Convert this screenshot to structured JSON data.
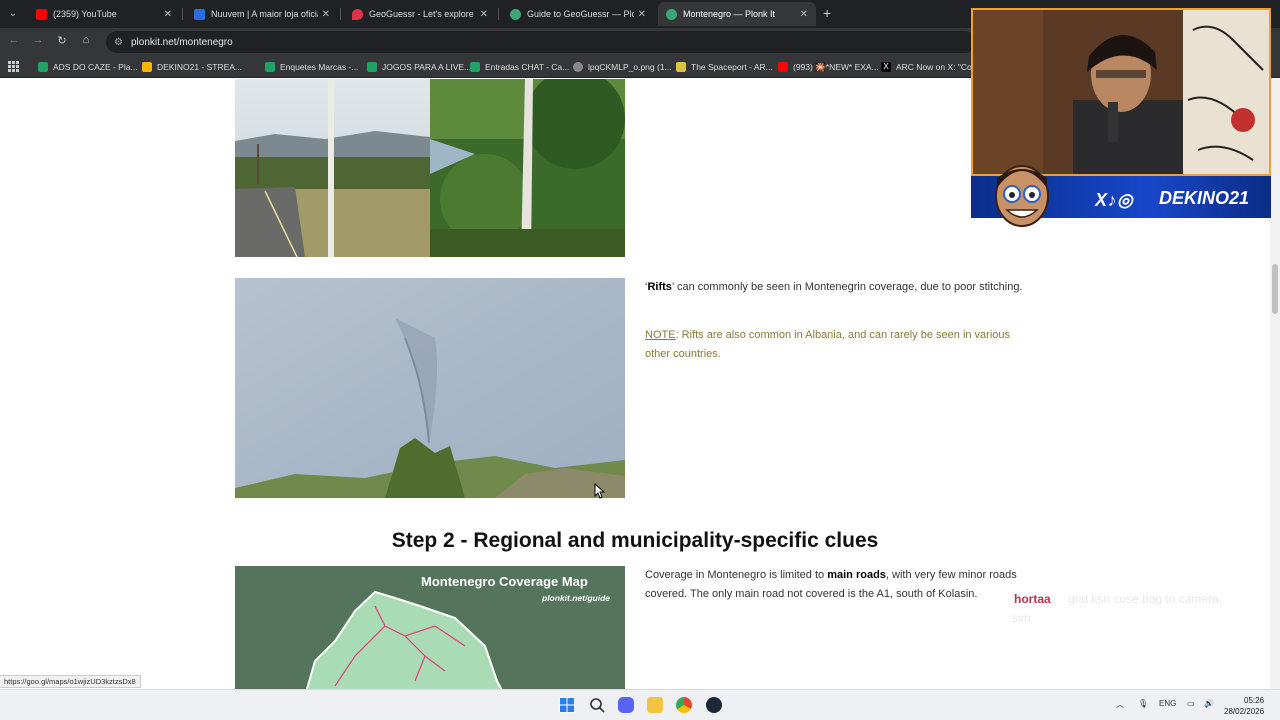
{
  "browser": {
    "tabs": [
      {
        "label": "(2359) YouTube",
        "color": "#ff0000",
        "icon": "youtube-icon"
      },
      {
        "label": "Nuuvem | A maior loja oficial de",
        "color": "#2b6de0",
        "icon": "nuuvem-icon"
      },
      {
        "label": "GeoGuessr - Let's explore the w",
        "color": "#e0334a",
        "icon": "map-pin-icon"
      },
      {
        "label": "Guide to GeoGuessr — Plonk It",
        "color": "#3aa876",
        "icon": "plonkit-icon"
      },
      {
        "label": "Montenegro — Plonk It",
        "color": "#3aa876",
        "icon": "plonkit-icon"
      }
    ],
    "url": "plonkit.net/montenegro",
    "bookmarks": [
      {
        "label": "ADS DO CAZE - Pla...",
        "color": "#1ea362",
        "icon": "sheets-icon"
      },
      {
        "label": "DEKINO21 - STREA...",
        "color": "#f4b400",
        "icon": "drive-icon"
      },
      {
        "label": "Enquetes Marcas -...",
        "color": "#1ea362",
        "icon": "sheets-icon"
      },
      {
        "label": "JOGOS PARA A LIVE...",
        "color": "#1ea362",
        "icon": "sheets-icon"
      },
      {
        "label": "Entradas CHAT - Ca...",
        "color": "#1ea362",
        "icon": "sheets-icon"
      },
      {
        "label": "lpqCKMLP_o.png (1...",
        "color": "#888888",
        "icon": "globe-icon"
      },
      {
        "label": "The Spaceport - AR...",
        "color": "#d9c341",
        "icon": "spaceport-icon"
      },
      {
        "label": "(993) 🎇*NEW* EXA...",
        "color": "#ff0000",
        "icon": "youtube-icon"
      },
      {
        "label": "ARC Now on X: \"Co...",
        "color": "#000000",
        "icon": "x-icon"
      }
    ]
  },
  "content": {
    "rifts_bold": "Rifts",
    "rifts_text": " can commonly be seen in Montenegrin coverage, due to poor stitching.",
    "note_label": "NOTE",
    "note_text": ": Rifts are also common in Albania, and can rarely be seen in various other countries.",
    "step_heading": "Step 2 - Regional and municipality-specific clues",
    "map_title": "Montenegro Coverage Map",
    "map_sub": "plonkit.net/guide",
    "coverage_pre": "Coverage in Montenegro is limited to ",
    "coverage_bold": "main roads",
    "coverage_post": ", with very few minor roads covered. The only main road not covered is the A1, south of Kolasin."
  },
  "overlay": {
    "channel": "DEKINO21",
    "social": "X♪◎",
    "chat_user": "hortaa",
    "chat_ghost": "gnd ksn cose bog to camera,",
    "chat_ghost2": "sim"
  },
  "status_url": "https://goo.gl/maps/o1wjizUD3kztzsDx8",
  "taskbar": {
    "lang": "ENG",
    "time": "05:26",
    "date": "28/02/2026"
  }
}
